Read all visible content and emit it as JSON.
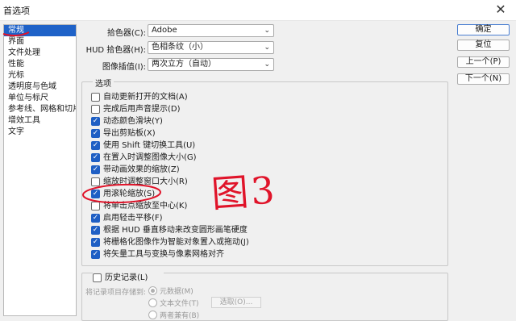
{
  "window": {
    "title": "首选项",
    "close_glyph": "✕"
  },
  "sidebar": {
    "items": [
      {
        "label": "常规"
      },
      {
        "label": "界面"
      },
      {
        "label": "文件处理"
      },
      {
        "label": "性能"
      },
      {
        "label": "光标"
      },
      {
        "label": "透明度与色域"
      },
      {
        "label": "单位与标尺"
      },
      {
        "label": "参考线、网格和切片"
      },
      {
        "label": "增效工具"
      },
      {
        "label": "文字"
      }
    ]
  },
  "top_fields": [
    {
      "label": "拾色器(C):",
      "value": "Adobe"
    },
    {
      "label": "HUD 拾色器(H):",
      "value": "色相条纹（小）"
    },
    {
      "label": "图像插值(I):",
      "value": "两次立方（自动）"
    }
  ],
  "options": {
    "title": "选项",
    "checkboxes": [
      {
        "label": "自动更新打开的文档(A)",
        "checked": false
      },
      {
        "label": "完成后用声音提示(D)",
        "checked": false
      },
      {
        "label": "动态颜色滑块(Y)",
        "checked": true
      },
      {
        "label": "导出剪贴板(X)",
        "checked": true
      },
      {
        "label": "使用 Shift 键切换工具(U)",
        "checked": true
      },
      {
        "label": "在置入时调整图像大小(G)",
        "checked": true
      },
      {
        "label": "带动画效果的缩放(Z)",
        "checked": true
      },
      {
        "label": "缩放时调整窗口大小(R)",
        "checked": false
      },
      {
        "label": "用滚轮缩放(S)",
        "checked": true
      },
      {
        "label": "将单击点缩放至中心(K)",
        "checked": false
      },
      {
        "label": "启用轻击平移(F)",
        "checked": true
      },
      {
        "label": "根据 HUD 垂直移动来改变圆形画笔硬度",
        "checked": true
      },
      {
        "label": "将栅格化图像作为智能对象置入或拖动(J)",
        "checked": true
      },
      {
        "label": "将矢量工具与变换与像素网格对齐",
        "checked": true
      }
    ]
  },
  "history": {
    "title": "历史记录(L)",
    "checked": false,
    "save_to_label": "将记录项目存储到:",
    "radio_metadata": "元数据(M)",
    "radio_textfile": "文本文件(T)",
    "radio_both": "两者兼有(B)",
    "choose_button": "选取(O)..."
  },
  "buttons": {
    "ok": "确定",
    "reset": "复位",
    "prev": "上一个(P)",
    "next": "下一个(N)"
  },
  "annotation": {
    "text": "图3",
    "color": "#e0142a"
  },
  "colors": {
    "accent": "#1f5fc4",
    "selection": "#1f62c8"
  }
}
